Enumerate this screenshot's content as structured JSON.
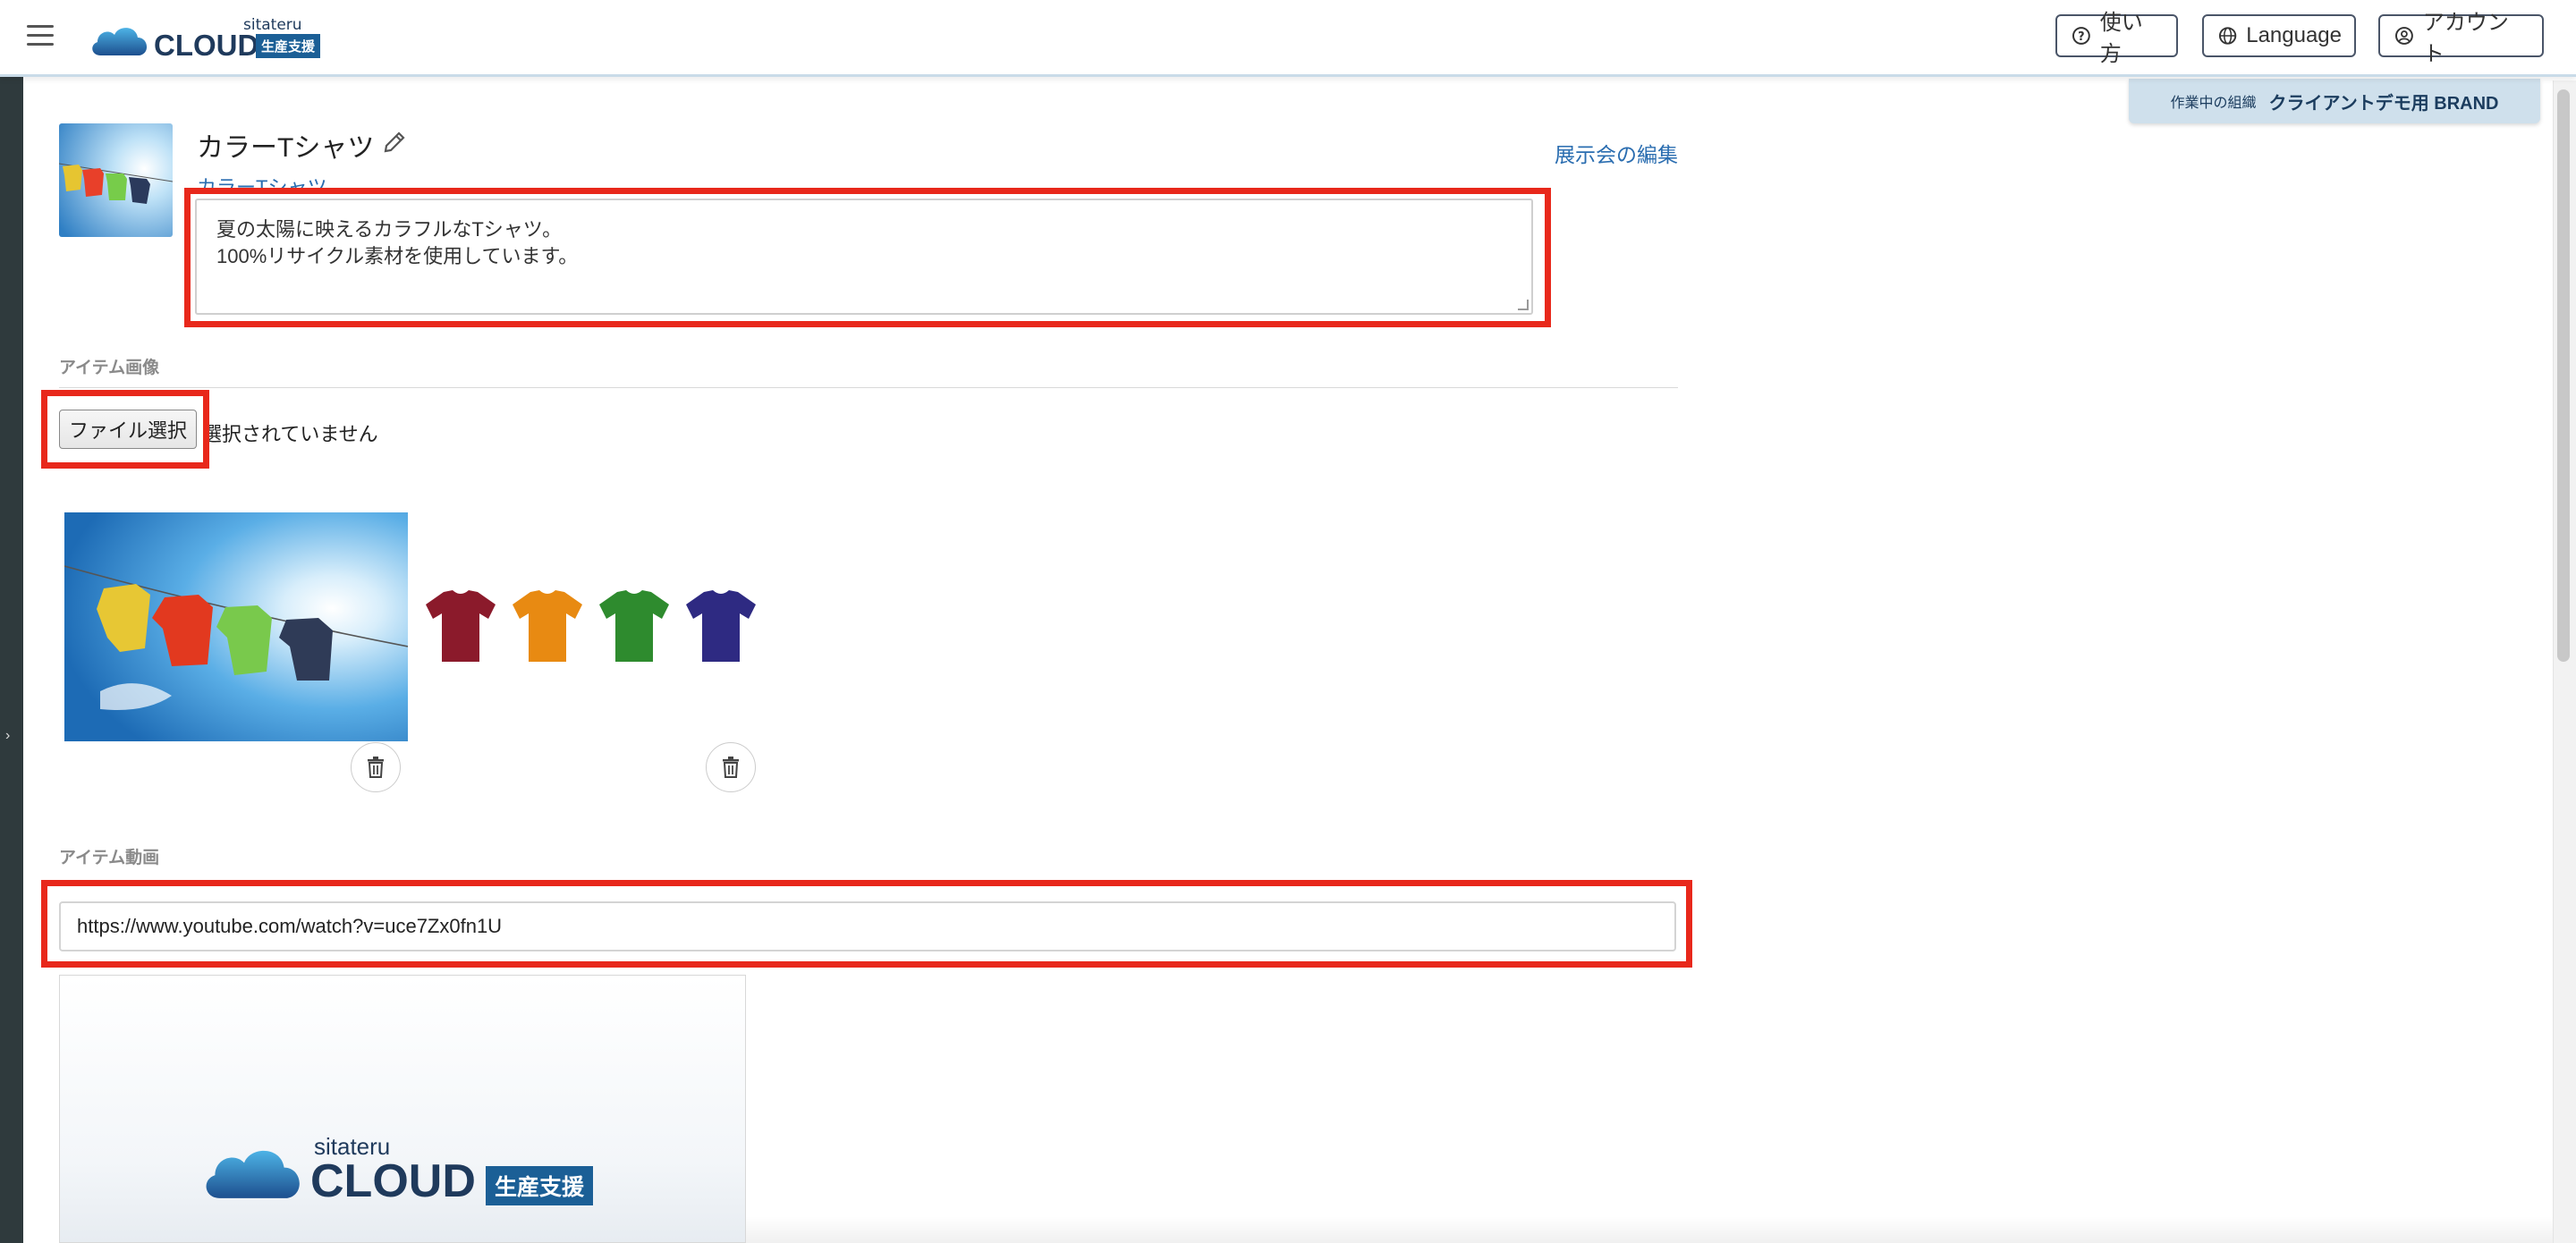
{
  "header": {
    "logo": {
      "sub": "sitateru",
      "main": "CLOUD",
      "badge": "生産支援"
    },
    "buttons": {
      "help": "使い方",
      "language": "Language",
      "account": "アカウント"
    }
  },
  "org_tag": {
    "label": "作業中の組織",
    "name": "クライアントデモ用 BRAND"
  },
  "item": {
    "title": "カラーTシャツ",
    "subtitle": "カラーTシャツ",
    "edit_link": "展示会の編集",
    "description_lines": [
      "夏の太陽に映えるカラフルなTシャツ。",
      "100%リサイクル素材を使用しています。"
    ]
  },
  "images_section": {
    "label": "アイテム画像",
    "file_button": "ファイル選択",
    "file_status": "選択されていません",
    "shirt_colors": [
      "#8b1a2b",
      "#e88a12",
      "#2e8b2e",
      "#2e2a82"
    ]
  },
  "video_section": {
    "label": "アイテム動画",
    "url": "https://www.youtube.com/watch?v=uce7Zx0fn1U",
    "preview_logo": {
      "sub": "sitateru",
      "main": "CLOUD",
      "badge": "生産支援"
    }
  },
  "icons": [
    "menu-icon",
    "help-icon",
    "globe-icon",
    "account-icon",
    "pencil-icon",
    "trash-icon",
    "cloud-logo-icon",
    "chevron-right-icon"
  ]
}
